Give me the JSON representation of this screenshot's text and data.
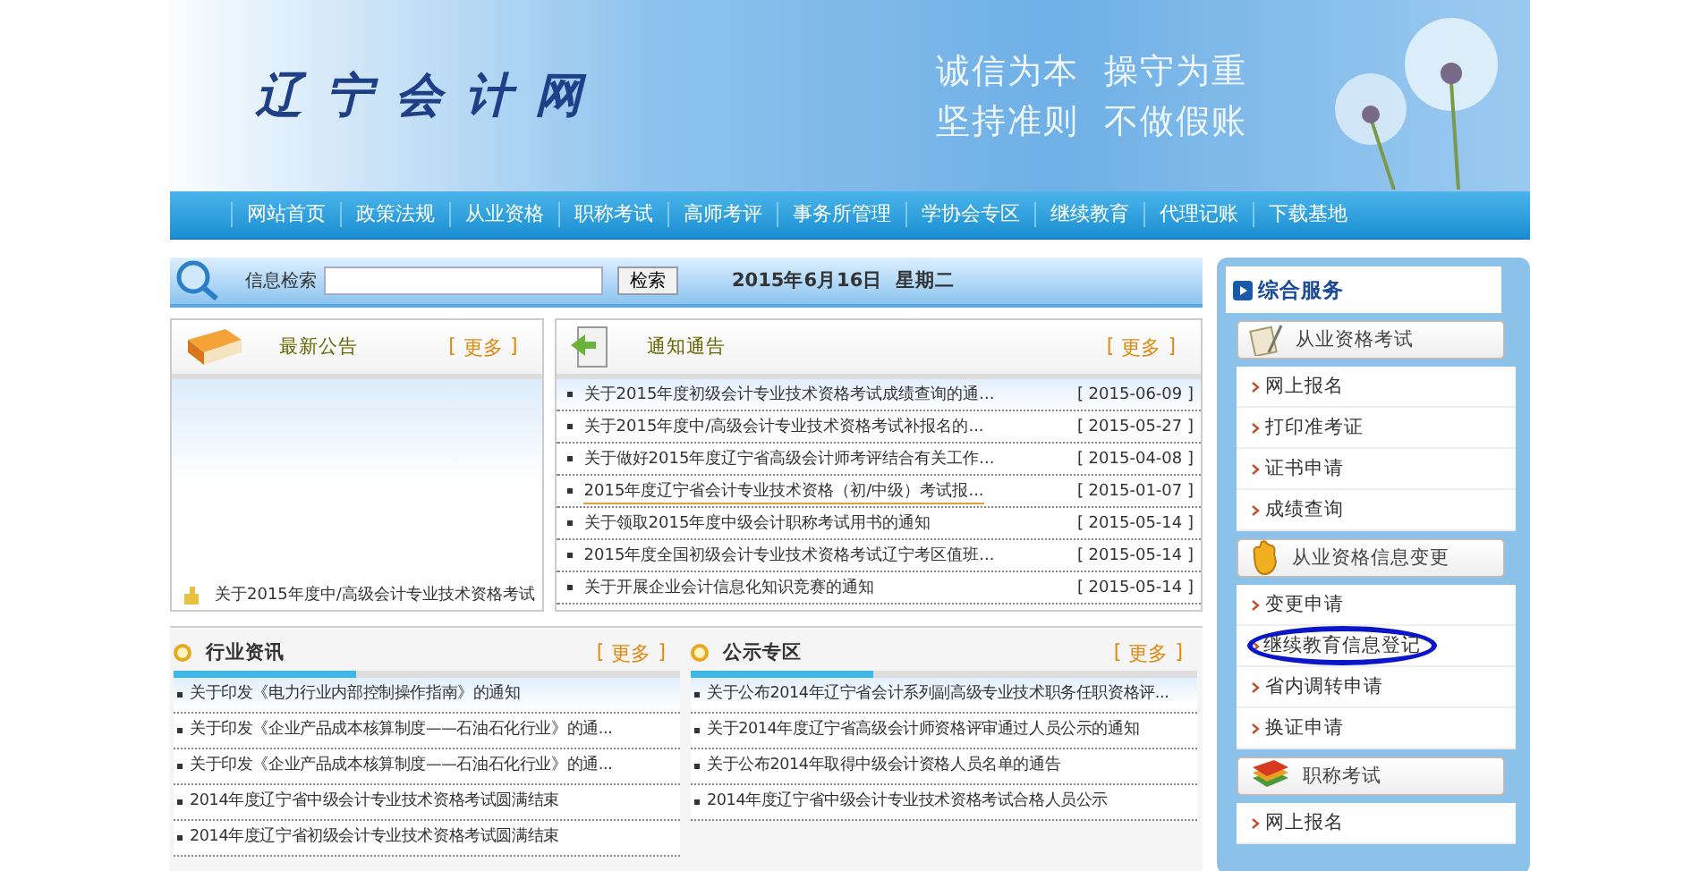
{
  "banner": {
    "logo": "辽 宁 会 计 网",
    "slogan": [
      "诚信为本  操守为重",
      "坚持准则  不做假账"
    ]
  },
  "nav": [
    "网站首页",
    "政策法规",
    "从业资格",
    "职称考试",
    "高师考评",
    "事务所管理",
    "学协会专区",
    "继续教育",
    "代理记账",
    "下载基地"
  ],
  "search": {
    "label": "信息检索",
    "button": "检索",
    "date": "2015年6月16日  星期二"
  },
  "latest": {
    "title": "最新公告",
    "more": [
      "[",
      "更多",
      "]"
    ],
    "items": [
      "关于2015年度中/高级会计专业技术资格考试"
    ]
  },
  "notices": {
    "title": "通知通告",
    "more": [
      "[",
      "更多",
      "]"
    ],
    "items": [
      {
        "title": "关于2015年度初级会计专业技术资格考试成绩查询的通...",
        "date": "[ 2015-06-09 ]",
        "hovered": false
      },
      {
        "title": "关于2015年度中/高级会计专业技术资格考试补报名的...",
        "date": "[ 2015-05-27 ]",
        "hovered": false
      },
      {
        "title": "关于做好2015年度辽宁省高级会计师考评结合有关工作...",
        "date": "[ 2015-04-08 ]",
        "hovered": false
      },
      {
        "title": "2015年度辽宁省会计专业技术资格（初/中级）考试报...",
        "date": "[ 2015-01-07 ]",
        "hovered": true
      },
      {
        "title": "关于领取2015年度中级会计职称考试用书的通知",
        "date": "[ 2015-05-14 ]",
        "hovered": false
      },
      {
        "title": "2015年度全国初级会计专业技术资格考试辽宁考区值班...",
        "date": "[ 2015-05-14 ]",
        "hovered": false
      },
      {
        "title": "关于开展企业会计信息化知识竞赛的通知",
        "date": "[ 2015-05-14 ]",
        "hovered": false
      }
    ]
  },
  "lower": [
    {
      "title": "行业资讯",
      "more": [
        "[",
        "更多",
        "]"
      ],
      "items": [
        "关于印发《电力行业内部控制操作指南》的通知",
        "关于印发《企业产品成本核算制度——石油石化行业》的通...",
        "关于印发《企业产品成本核算制度——石油石化行业》的通...",
        "2014年度辽宁省中级会计专业技术资格考试圆满结束",
        "2014年度辽宁省初级会计专业技术资格考试圆满结束"
      ]
    },
    {
      "title": "公示专区",
      "more": [
        "[",
        "更多",
        "]"
      ],
      "items": [
        "关于公布2014年辽宁省会计系列副高级专业技术职务任职资格评...",
        "关于2014年度辽宁省高级会计师资格评审通过人员公示的通知",
        "关于公布2014年取得中级会计资格人员名单的通告",
        "2014年度辽宁省中级会计专业技术资格考试合格人员公示"
      ]
    }
  ],
  "sidebar": {
    "title": "综合服务",
    "groups": [
      {
        "title": "从业资格考试",
        "kind": "paper",
        "items": [
          {
            "label": "网上报名",
            "circled": false
          },
          {
            "label": "打印准考证",
            "circled": false
          },
          {
            "label": "证书申请",
            "circled": false
          },
          {
            "label": "成绩查询",
            "circled": false
          }
        ]
      },
      {
        "title": "从业资格信息变更",
        "kind": "hand",
        "items": [
          {
            "label": "变更申请",
            "circled": false
          },
          {
            "label": "继续教育信息登记",
            "circled": true
          },
          {
            "label": "省内调转申请",
            "circled": false
          },
          {
            "label": "换证申请",
            "circled": false
          }
        ]
      },
      {
        "title": "职称考试",
        "kind": "books",
        "items": [
          {
            "label": "网上报名",
            "circled": false
          }
        ]
      }
    ]
  }
}
